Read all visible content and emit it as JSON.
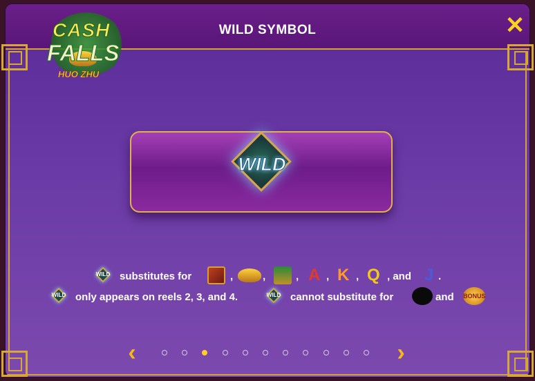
{
  "header": {
    "title": "WILD SYMBOL",
    "close_icon": "close-icon",
    "logo": {
      "line1": "CASH",
      "line2": "FALLS",
      "line3": "HUO ZHU"
    }
  },
  "feature": {
    "symbol_name": "WILD"
  },
  "text": {
    "row1_substitutes": "substitutes for",
    "comma": ",",
    "and": ", and",
    "period": ".",
    "row2_only": "only appears on reels 2, 3, and 4.",
    "row2_cannot": "cannot substitute for",
    "row2_and": "and",
    "wild_badge": "WILD",
    "bonus_badge": "BONUS",
    "letters": [
      "A",
      "K",
      "Q",
      "J"
    ]
  },
  "pagination": {
    "total": 11,
    "active_index": 2,
    "prev_icon": "chevron-left-icon",
    "next_icon": "chevron-right-icon"
  },
  "colors": {
    "accent_gold": "#ffd21f",
    "frame_gold": "#d4a534",
    "panel_purple": "#6a3aa6"
  }
}
